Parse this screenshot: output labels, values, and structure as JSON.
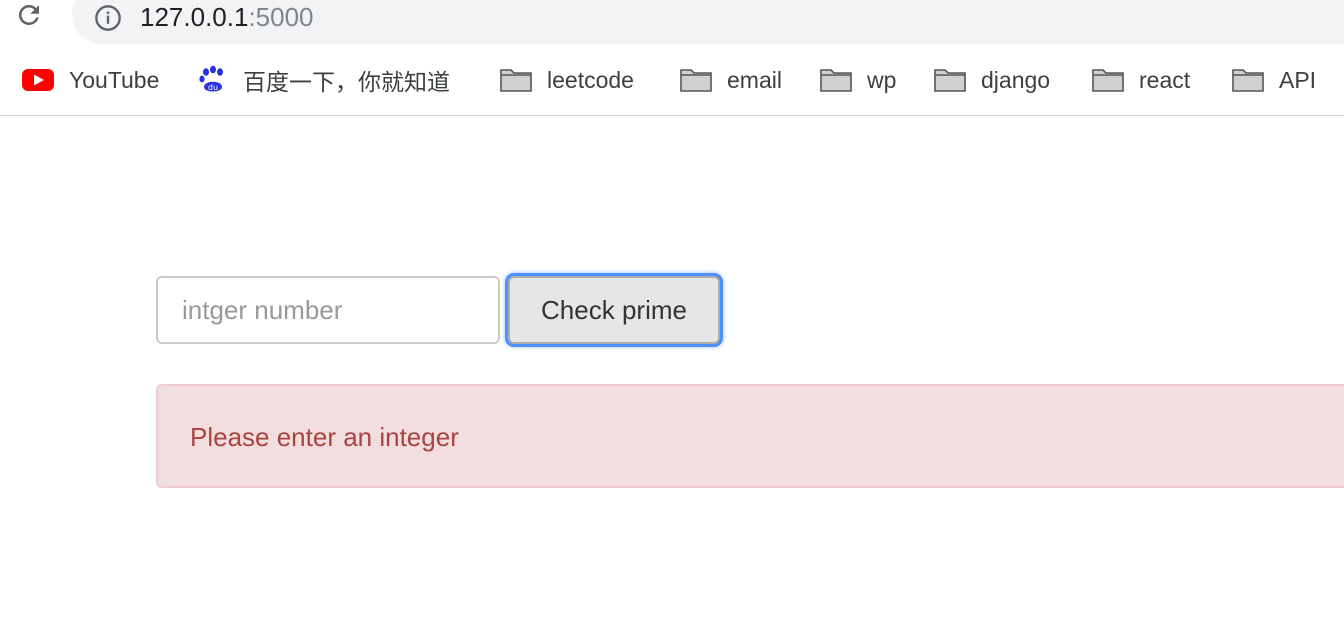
{
  "browser": {
    "url_host": "127.0.0.1",
    "url_port": ":5000",
    "reload_icon": "reload-icon",
    "info_icon": "info-icon"
  },
  "bookmarks": [
    {
      "label": "YouTube",
      "icon": "youtube-icon"
    },
    {
      "label": "百度一下，你就知道",
      "icon": "baidu-paw-icon"
    },
    {
      "label": "leetcode",
      "icon": "folder-icon"
    },
    {
      "label": "email",
      "icon": "folder-icon"
    },
    {
      "label": "wp",
      "icon": "folder-icon"
    },
    {
      "label": "django",
      "icon": "folder-icon"
    },
    {
      "label": "react",
      "icon": "folder-icon"
    },
    {
      "label": "API",
      "icon": "folder-icon"
    }
  ],
  "form": {
    "input_placeholder": "intger number",
    "input_value": "",
    "submit_label": "Check prime"
  },
  "alert": {
    "message": "Please enter an integer",
    "type": "danger"
  },
  "colors": {
    "alert_background": "#f2dede",
    "alert_text": "#a94442",
    "focus_ring": "#4d90fe",
    "youtube_red": "#ff0000",
    "baidu_blue": "#2932e1"
  }
}
